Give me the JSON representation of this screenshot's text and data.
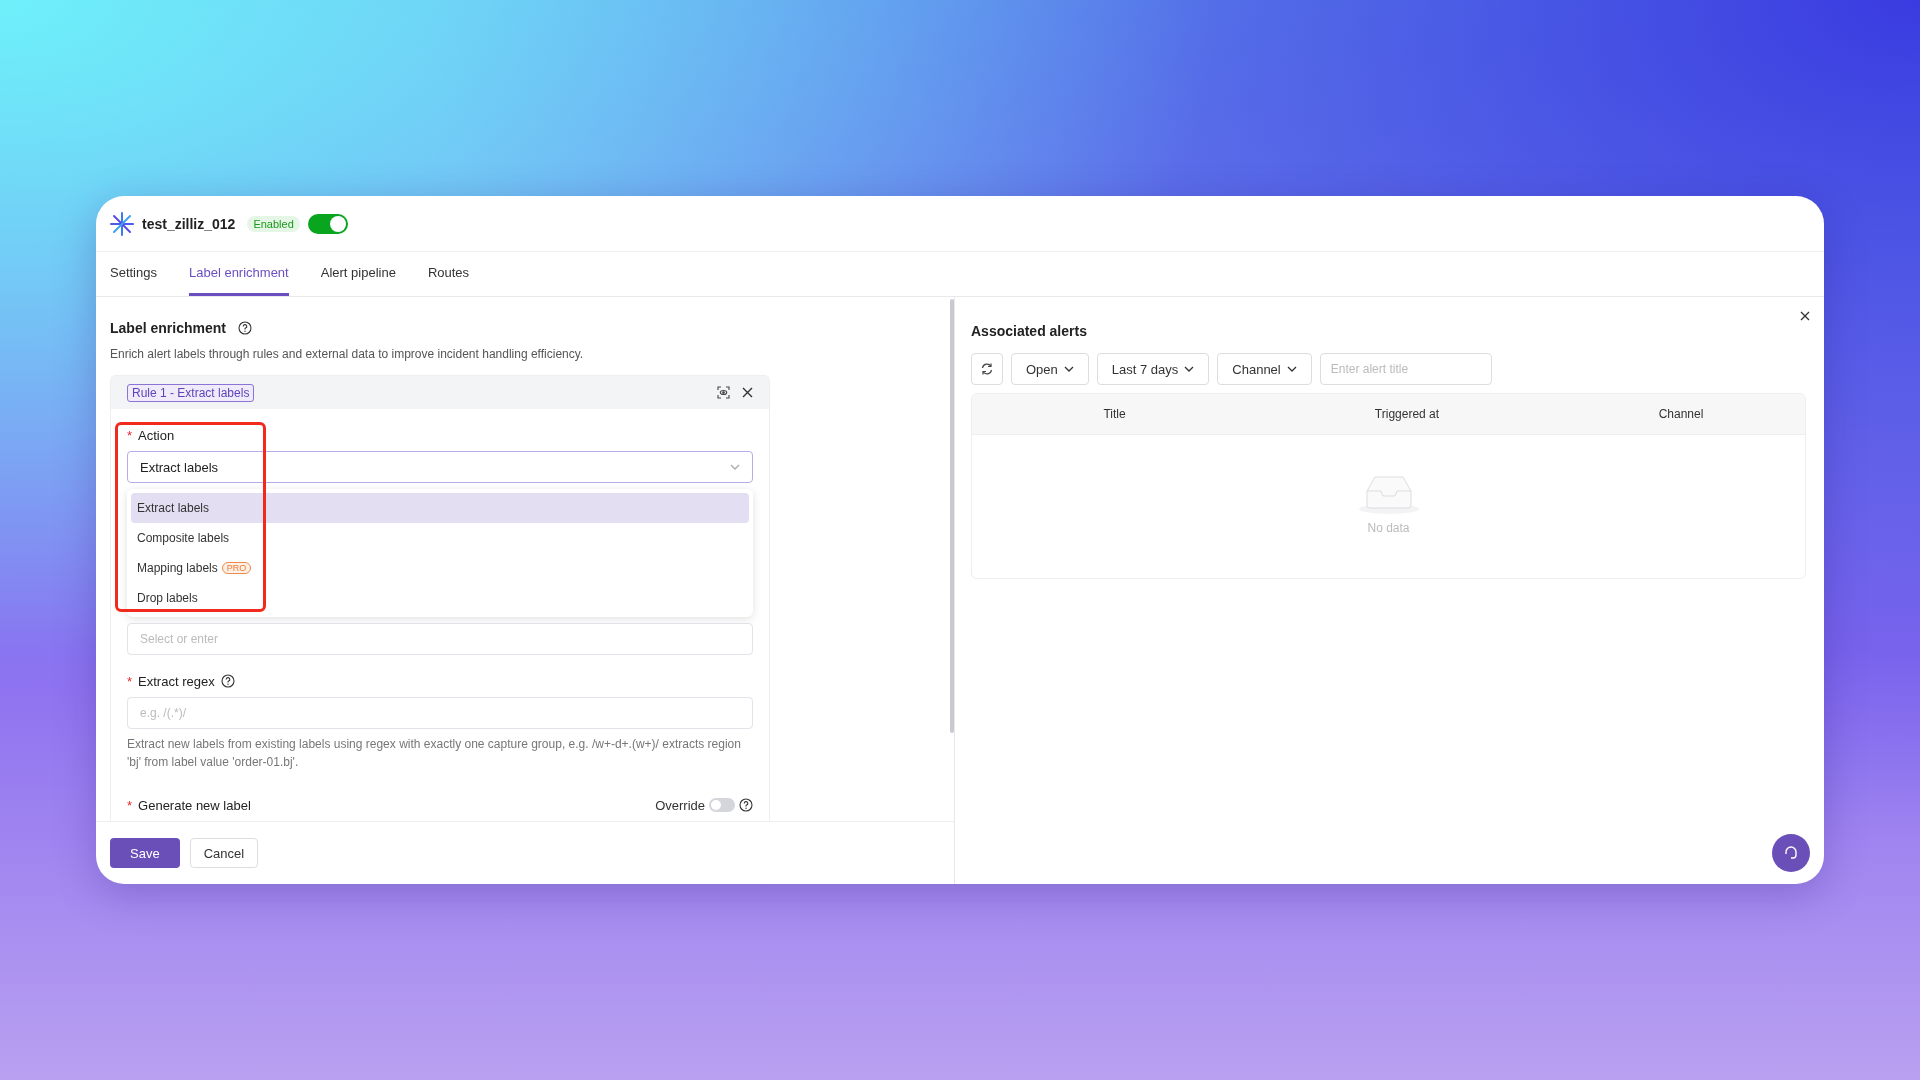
{
  "app": {
    "name": "test_zilliz_012",
    "status": "Enabled",
    "enabled": true
  },
  "tabs": [
    {
      "label": "Settings",
      "selected": false
    },
    {
      "label": "Label enrichment",
      "selected": true
    },
    {
      "label": "Alert pipeline",
      "selected": false
    },
    {
      "label": "Routes",
      "selected": false
    }
  ],
  "section": {
    "title": "Label enrichment",
    "description": "Enrich alert labels through rules and external data to improve incident handling efficiency."
  },
  "rule": {
    "tag": "Rule 1 - Extract labels"
  },
  "action": {
    "label": "Action",
    "required_mark": "*",
    "value": "Extract labels",
    "expanded": true,
    "options": [
      {
        "label": "Extract labels",
        "selected": true
      },
      {
        "label": "Composite labels",
        "selected": false
      },
      {
        "label": "Mapping labels",
        "badge": "PRO",
        "selected": false
      },
      {
        "label": "Drop labels",
        "selected": false
      }
    ]
  },
  "source_field": {
    "placeholder": "Select or enter"
  },
  "regex": {
    "label": "Extract regex",
    "required_mark": "*",
    "placeholder": "e.g. /(.*)/",
    "help": "Extract new labels from existing labels using regex with exactly one capture group, e.g. /w+-d+.(w+)/ extracts region 'bj' from label value 'order-01.bj'."
  },
  "new_label": {
    "label": "Generate new label",
    "required_mark": "*",
    "override_label": "Override",
    "override_on": false
  },
  "footer_buttons": [
    {
      "label": "Save",
      "kind": "primary"
    },
    {
      "label": "Cancel",
      "kind": "default"
    }
  ],
  "alerts": {
    "title": "Associated alerts",
    "filters": [
      {
        "label": "Open"
      },
      {
        "label": "Last 7 days"
      },
      {
        "label": "Channel"
      }
    ],
    "search": {
      "placeholder": "Enter alert title"
    },
    "columns": [
      "Title",
      "Triggered at",
      "Channel"
    ],
    "empty_text": "No data"
  }
}
